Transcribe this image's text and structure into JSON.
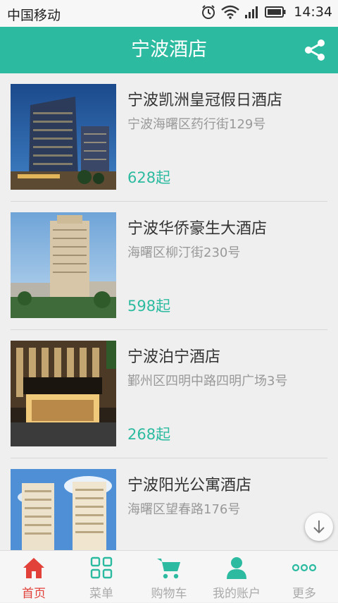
{
  "status_bar": {
    "carrier": "中国移动",
    "time": "14:34"
  },
  "header": {
    "title": "宁波酒店",
    "share_icon": "share-icon"
  },
  "colors": {
    "accent": "#2cbba0",
    "active_tab": "#e2413a",
    "price": "#2cbba0"
  },
  "hotels": [
    {
      "name": "宁波凯洲皇冠假日酒店",
      "address": "宁波海曙区药行街129号",
      "price": "628起"
    },
    {
      "name": "宁波华侨豪生大酒店",
      "address": "海曙区柳汀街230号",
      "price": "598起"
    },
    {
      "name": "宁波泊宁酒店",
      "address": "鄞州区四明中路四明广场3号",
      "price": "268起"
    },
    {
      "name": "宁波阳光公寓酒店",
      "address": "海曙区望春路176号",
      "price": ""
    }
  ],
  "bottom_nav": [
    {
      "label": "首页",
      "icon": "home-icon",
      "active": true
    },
    {
      "label": "菜单",
      "icon": "menu-grid-icon",
      "active": false
    },
    {
      "label": "购物车",
      "icon": "cart-icon",
      "active": false
    },
    {
      "label": "我的账户",
      "icon": "account-icon",
      "active": false
    },
    {
      "label": "更多",
      "icon": "more-icon",
      "active": false
    }
  ]
}
